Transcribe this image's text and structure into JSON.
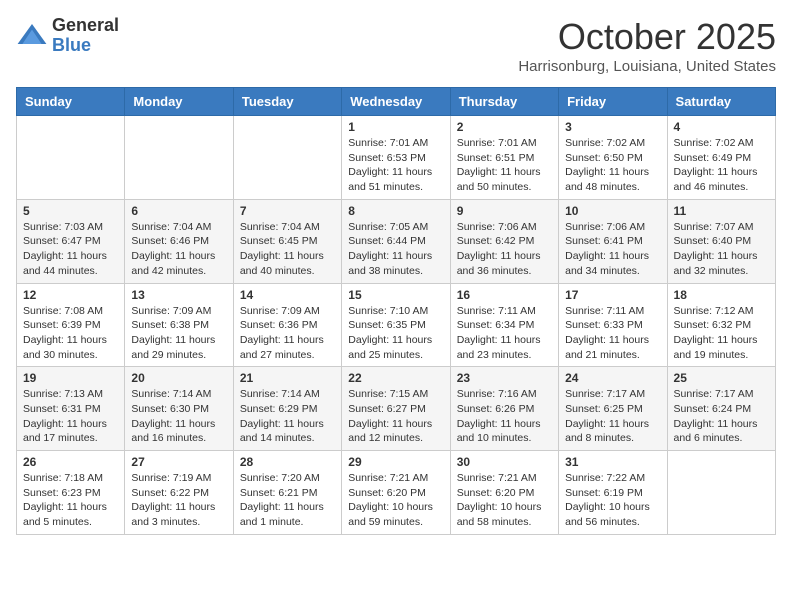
{
  "header": {
    "logo_general": "General",
    "logo_blue": "Blue",
    "month_title": "October 2025",
    "location": "Harrisonburg, Louisiana, United States"
  },
  "days_of_week": [
    "Sunday",
    "Monday",
    "Tuesday",
    "Wednesday",
    "Thursday",
    "Friday",
    "Saturday"
  ],
  "weeks": [
    [
      {
        "day": "",
        "info": ""
      },
      {
        "day": "",
        "info": ""
      },
      {
        "day": "",
        "info": ""
      },
      {
        "day": "1",
        "info": "Sunrise: 7:01 AM\nSunset: 6:53 PM\nDaylight: 11 hours\nand 51 minutes."
      },
      {
        "day": "2",
        "info": "Sunrise: 7:01 AM\nSunset: 6:51 PM\nDaylight: 11 hours\nand 50 minutes."
      },
      {
        "day": "3",
        "info": "Sunrise: 7:02 AM\nSunset: 6:50 PM\nDaylight: 11 hours\nand 48 minutes."
      },
      {
        "day": "4",
        "info": "Sunrise: 7:02 AM\nSunset: 6:49 PM\nDaylight: 11 hours\nand 46 minutes."
      }
    ],
    [
      {
        "day": "5",
        "info": "Sunrise: 7:03 AM\nSunset: 6:47 PM\nDaylight: 11 hours\nand 44 minutes."
      },
      {
        "day": "6",
        "info": "Sunrise: 7:04 AM\nSunset: 6:46 PM\nDaylight: 11 hours\nand 42 minutes."
      },
      {
        "day": "7",
        "info": "Sunrise: 7:04 AM\nSunset: 6:45 PM\nDaylight: 11 hours\nand 40 minutes."
      },
      {
        "day": "8",
        "info": "Sunrise: 7:05 AM\nSunset: 6:44 PM\nDaylight: 11 hours\nand 38 minutes."
      },
      {
        "day": "9",
        "info": "Sunrise: 7:06 AM\nSunset: 6:42 PM\nDaylight: 11 hours\nand 36 minutes."
      },
      {
        "day": "10",
        "info": "Sunrise: 7:06 AM\nSunset: 6:41 PM\nDaylight: 11 hours\nand 34 minutes."
      },
      {
        "day": "11",
        "info": "Sunrise: 7:07 AM\nSunset: 6:40 PM\nDaylight: 11 hours\nand 32 minutes."
      }
    ],
    [
      {
        "day": "12",
        "info": "Sunrise: 7:08 AM\nSunset: 6:39 PM\nDaylight: 11 hours\nand 30 minutes."
      },
      {
        "day": "13",
        "info": "Sunrise: 7:09 AM\nSunset: 6:38 PM\nDaylight: 11 hours\nand 29 minutes."
      },
      {
        "day": "14",
        "info": "Sunrise: 7:09 AM\nSunset: 6:36 PM\nDaylight: 11 hours\nand 27 minutes."
      },
      {
        "day": "15",
        "info": "Sunrise: 7:10 AM\nSunset: 6:35 PM\nDaylight: 11 hours\nand 25 minutes."
      },
      {
        "day": "16",
        "info": "Sunrise: 7:11 AM\nSunset: 6:34 PM\nDaylight: 11 hours\nand 23 minutes."
      },
      {
        "day": "17",
        "info": "Sunrise: 7:11 AM\nSunset: 6:33 PM\nDaylight: 11 hours\nand 21 minutes."
      },
      {
        "day": "18",
        "info": "Sunrise: 7:12 AM\nSunset: 6:32 PM\nDaylight: 11 hours\nand 19 minutes."
      }
    ],
    [
      {
        "day": "19",
        "info": "Sunrise: 7:13 AM\nSunset: 6:31 PM\nDaylight: 11 hours\nand 17 minutes."
      },
      {
        "day": "20",
        "info": "Sunrise: 7:14 AM\nSunset: 6:30 PM\nDaylight: 11 hours\nand 16 minutes."
      },
      {
        "day": "21",
        "info": "Sunrise: 7:14 AM\nSunset: 6:29 PM\nDaylight: 11 hours\nand 14 minutes."
      },
      {
        "day": "22",
        "info": "Sunrise: 7:15 AM\nSunset: 6:27 PM\nDaylight: 11 hours\nand 12 minutes."
      },
      {
        "day": "23",
        "info": "Sunrise: 7:16 AM\nSunset: 6:26 PM\nDaylight: 11 hours\nand 10 minutes."
      },
      {
        "day": "24",
        "info": "Sunrise: 7:17 AM\nSunset: 6:25 PM\nDaylight: 11 hours\nand 8 minutes."
      },
      {
        "day": "25",
        "info": "Sunrise: 7:17 AM\nSunset: 6:24 PM\nDaylight: 11 hours\nand 6 minutes."
      }
    ],
    [
      {
        "day": "26",
        "info": "Sunrise: 7:18 AM\nSunset: 6:23 PM\nDaylight: 11 hours\nand 5 minutes."
      },
      {
        "day": "27",
        "info": "Sunrise: 7:19 AM\nSunset: 6:22 PM\nDaylight: 11 hours\nand 3 minutes."
      },
      {
        "day": "28",
        "info": "Sunrise: 7:20 AM\nSunset: 6:21 PM\nDaylight: 11 hours\nand 1 minute."
      },
      {
        "day": "29",
        "info": "Sunrise: 7:21 AM\nSunset: 6:20 PM\nDaylight: 10 hours\nand 59 minutes."
      },
      {
        "day": "30",
        "info": "Sunrise: 7:21 AM\nSunset: 6:20 PM\nDaylight: 10 hours\nand 58 minutes."
      },
      {
        "day": "31",
        "info": "Sunrise: 7:22 AM\nSunset: 6:19 PM\nDaylight: 10 hours\nand 56 minutes."
      },
      {
        "day": "",
        "info": ""
      }
    ]
  ]
}
